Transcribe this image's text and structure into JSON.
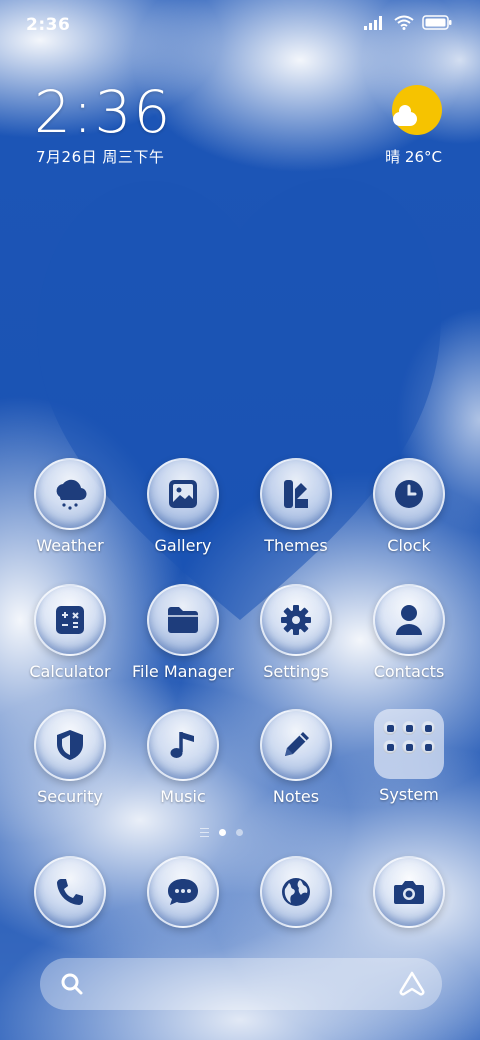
{
  "status_bar": {
    "time": "2:36",
    "icons": [
      "signal-icon",
      "wifi-icon",
      "battery-icon"
    ]
  },
  "clock_widget": {
    "time": "2:36",
    "date": "7月26日 周三下午"
  },
  "weather_widget": {
    "text": "晴 26°C",
    "icon": "sunny-cloud-icon"
  },
  "colors": {
    "icon_glyph": "#1e3d7c",
    "sun": "#f6c300"
  },
  "apps": [
    {
      "label": "Weather",
      "icon": "weather-icon"
    },
    {
      "label": "Gallery",
      "icon": "gallery-icon"
    },
    {
      "label": "Themes",
      "icon": "themes-icon"
    },
    {
      "label": "Clock",
      "icon": "clock-icon"
    },
    {
      "label": "Calculator",
      "icon": "calculator-icon"
    },
    {
      "label": "File Manager",
      "icon": "folder-icon"
    },
    {
      "label": "Settings",
      "icon": "gear-icon"
    },
    {
      "label": "Contacts",
      "icon": "contacts-icon"
    },
    {
      "label": "Security",
      "icon": "shield-icon"
    },
    {
      "label": "Music",
      "icon": "music-icon"
    },
    {
      "label": "Notes",
      "icon": "pencil-icon"
    },
    {
      "label": "System",
      "icon": "folder-system-icon"
    }
  ],
  "dock": [
    {
      "icon": "phone-icon"
    },
    {
      "icon": "messages-icon"
    },
    {
      "icon": "browser-icon"
    },
    {
      "icon": "camera-icon"
    }
  ],
  "page_indicator": {
    "current": 1,
    "pages": 2
  },
  "search": {
    "icon": "search-icon",
    "assistant_icon": "assistant-icon"
  }
}
